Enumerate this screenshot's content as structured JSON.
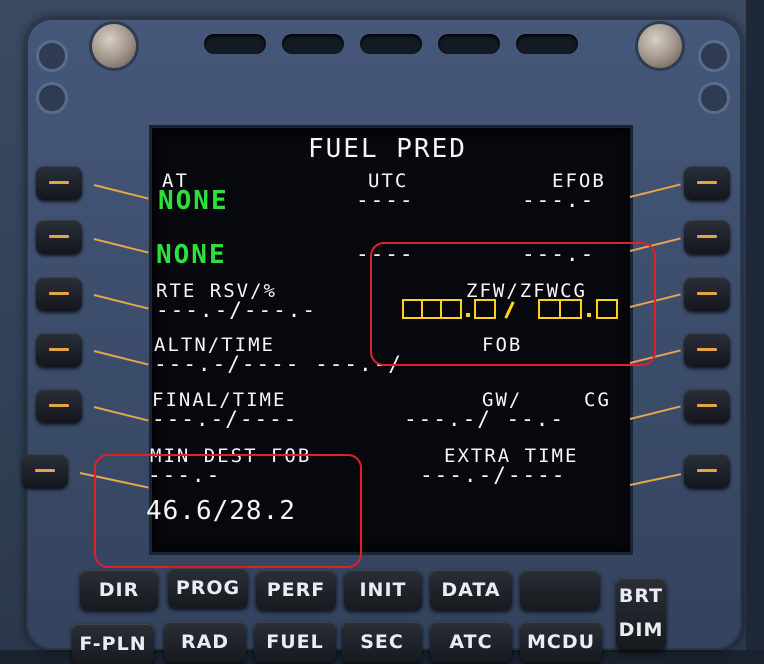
{
  "screen": {
    "title": "FUEL PRED",
    "rows": [
      {
        "label_left": "AT",
        "value_left": "NONE",
        "label_center": "UTC",
        "value_center": "----",
        "label_right": "EFOB",
        "value_right": "---.-"
      },
      {
        "value_left": "NONE",
        "value_center": "----",
        "value_right": "---.-"
      },
      {
        "label_left": "RTE RSV/%",
        "value_left": "---.-/---.-",
        "label_right": "ZFW/ZFWCG"
      },
      {
        "label_left": "ALTN/TIME",
        "value_left": "---.-/---- ---.-/----",
        "label_right": "FOB"
      },
      {
        "label_left": "FINAL/TIME",
        "value_left": "---.-/----",
        "label_right_a": "GW/",
        "label_right_b": "CG",
        "value_right": "---.-/ --.-"
      },
      {
        "label_left": "MIN DEST FOB",
        "value_left": "---.-",
        "label_right": "EXTRA TIME",
        "value_right": "---.-/----"
      }
    ],
    "annotation_value": "46.6/28.2",
    "colors": {
      "label": "#f4f6fa",
      "green": "#2ee03c",
      "amber_box": "#ffd21a",
      "highlight": "#e0202a"
    }
  },
  "keys": {
    "row1": [
      "DIR",
      "PROG",
      "PERF",
      "INIT",
      "DATA",
      ""
    ],
    "row2": [
      "F-PLN",
      "RAD",
      "FUEL",
      "SEC",
      "ATC",
      "MCDU"
    ],
    "brt": "BRT",
    "dim": "DIM"
  }
}
